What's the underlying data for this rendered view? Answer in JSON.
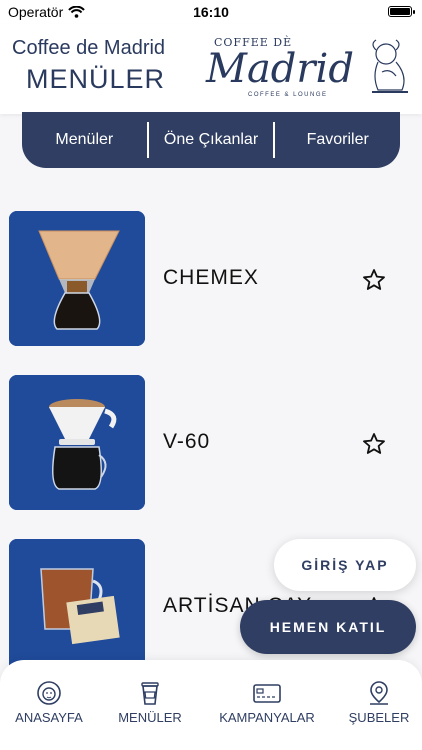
{
  "status_bar": {
    "carrier": "Operatör",
    "time": "16:10"
  },
  "header": {
    "subtitle": "Coffee de Madrid",
    "title": "MENÜLER",
    "logo": {
      "top_text": "COFFEE DÈ",
      "script": "Madrid",
      "bottom_text": "COFFEE & LOUNGE"
    }
  },
  "segments": [
    {
      "label": "Menüler"
    },
    {
      "label": "Öne Çıkanlar"
    },
    {
      "label": "Favoriler"
    }
  ],
  "menu_items": [
    {
      "name": "CHEMEX",
      "image": "chemex-photo",
      "favorite": false
    },
    {
      "name": "V-60",
      "image": "v60-photo",
      "favorite": false
    },
    {
      "name": "ARTİSAN ÇAY",
      "image": "artisan-tea-photo",
      "favorite": false
    }
  ],
  "buttons": {
    "login": "GİRİŞ YAP",
    "join": "HEMEN KATIL"
  },
  "tabbar": [
    {
      "label": "ANASAYFA",
      "icon": "lion-icon"
    },
    {
      "label": "MENÜLER",
      "icon": "cup-icon"
    },
    {
      "label": "KAMPANYALAR",
      "icon": "card-icon"
    },
    {
      "label": "ŞUBELER",
      "icon": "map-pin-icon"
    }
  ],
  "colors": {
    "navy": "#2f3e62",
    "thumb_bg": "#1f4b9a",
    "background": "#f6f6f8"
  }
}
